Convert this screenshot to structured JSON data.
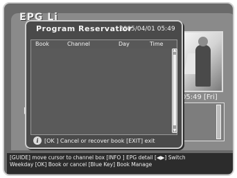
{
  "background": {
    "title": "EPG Li",
    "time_label": "05:49 [Fri]",
    "left_bracket": "["
  },
  "dialog": {
    "title": "Program Reservatior",
    "datetime": "2005/04/01 05:49",
    "columns": [
      "Book",
      "Channel",
      "Day",
      "Time"
    ],
    "rows": [],
    "help_text": "[OK ] Cancel or recover book [EXIT] exit"
  },
  "footer": {
    "line1": "[GUIDE] move cursor to channel box  [INFO ] EPG detail [◀▶] Switch",
    "line2": "Weekday [OK] Book or cancel [Blue Key] Book Manage"
  },
  "colors": {
    "dialog_bg": "#4a4a4a",
    "border": "#cfcfcf",
    "text": "#f4f4f4"
  }
}
